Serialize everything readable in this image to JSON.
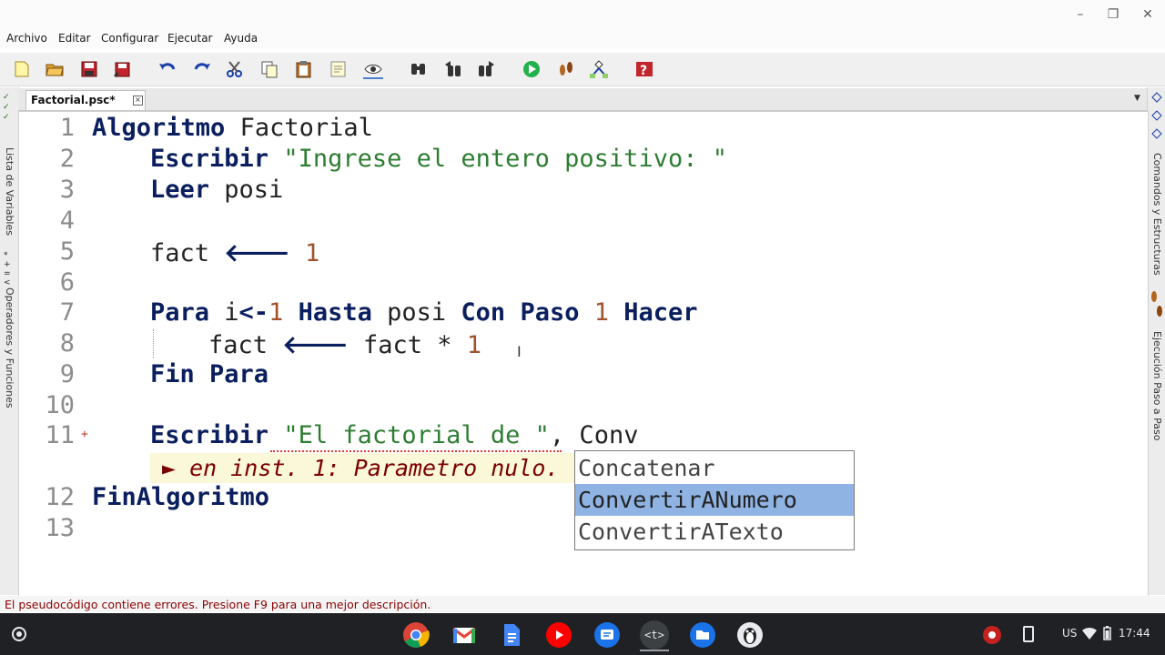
{
  "window": {
    "minimize_glyph": "–",
    "maximize_glyph": "❐",
    "close_glyph": "✕"
  },
  "menu": [
    "Archivo",
    "Editar",
    "Configurar",
    "Ejecutar",
    "Ayuda"
  ],
  "toolbar_icons": [
    "new-file-icon",
    "open-folder-icon",
    "save-icon",
    "save-as-icon",
    "undo-icon",
    "redo-icon",
    "cut-icon",
    "copy-icon",
    "paste-icon",
    "edit-icon",
    "indent-icon",
    "search-icon",
    "search-prev-icon",
    "search-next-icon",
    "run-icon",
    "step-icon",
    "flowchart-icon",
    "help-icon"
  ],
  "left_panel": {
    "section1": "Lista de Variables",
    "section2": "Operadores y Funciones"
  },
  "right_panel": {
    "section1": "Comandos y Estructuras",
    "section2": "Ejecución Paso a Paso"
  },
  "tab": {
    "label": "Factorial.psc*",
    "close": "×",
    "menu_arrow": "▼"
  },
  "code": {
    "line_numbers": [
      "1",
      "2",
      "3",
      "4",
      "5",
      "6",
      "7",
      "8",
      "9",
      "10",
      "11",
      "12",
      "13"
    ],
    "l1": {
      "kw": "Algoritmo",
      "rest": " Factorial"
    },
    "l2": {
      "kw": "Escribir",
      "str": "\"Ingrese el entero positivo: \""
    },
    "l3": {
      "kw": "Leer",
      "rest": " posi"
    },
    "l5": {
      "var": "fact",
      "arrow": "🡐",
      "num": "1"
    },
    "l7": {
      "kw1": "Para",
      "var": " i",
      "op": "<-",
      "num1": "1",
      "kw2": "Hasta",
      "var2": " posi ",
      "kw3": "Con Paso",
      "num2": "1",
      "kw4": "Hacer"
    },
    "l8": {
      "var": "fact",
      "arrow": "🡐",
      "expr": " fact * ",
      "num": "1"
    },
    "l9": {
      "kw": "Fin Para"
    },
    "l11": {
      "kw": "Escribir",
      "str": "\"El factorial de \"",
      "rest": ", Conv"
    },
    "l12": {
      "kw": "FinAlgoritmo"
    }
  },
  "line11_marker": "+",
  "error_hint": "► en inst. 1: Parametro nulo.",
  "autocomplete": {
    "items": [
      "Concatenar",
      "ConvertirANumero",
      "ConvertirATexto"
    ],
    "selected_index": 1
  },
  "mouse_cursor": "I",
  "status": "El pseudocódigo contiene errores. Presione F9 para una mejor descripción.",
  "shelf": {
    "apps": [
      "chrome-icon",
      "gmail-icon",
      "docs-icon",
      "youtube-icon",
      "messages-icon",
      "text-editor-icon",
      "files-icon",
      "linux-penguin-icon"
    ],
    "text_editor_glyph": "<t>",
    "locale": "US",
    "time": "17:44"
  }
}
